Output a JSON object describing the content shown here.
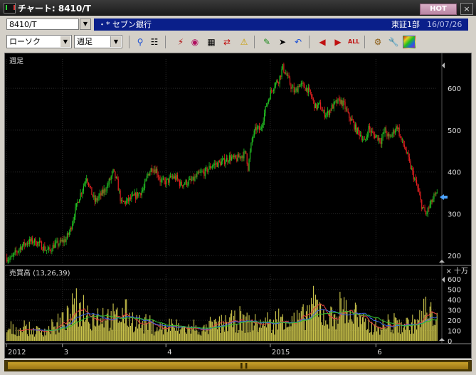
{
  "window": {
    "title": "チャート: 8410/T",
    "hot_label": "HOT",
    "close_glyph": "×"
  },
  "info": {
    "code": "8410/T",
    "stock_name": "セブン銀行",
    "market": "東証1部",
    "date": "16/07/26"
  },
  "toolbar": {
    "chart_type": "ローソク",
    "period": "週足",
    "buttons": [
      "zoom-icon",
      "crosshair-icon",
      "wave-icon",
      "magnify-icon",
      "table-icon",
      "arrows-icon",
      "warning-icon",
      "pencil-icon",
      "cursor-icon",
      "undo-icon",
      "move-left-icon",
      "move-right-icon",
      "all-icon",
      "settings-icon",
      "wrench-icon",
      "palette-icon"
    ],
    "all_label": "ALL"
  },
  "chart_data": [
    {
      "type": "candlestick",
      "panel_label": "週足",
      "ylim": [
        180,
        670
      ],
      "yticks": [
        200,
        300,
        400,
        500,
        600
      ],
      "x_labels": [
        "2012",
        "3",
        "4",
        "2015",
        "6"
      ],
      "current_price_marker": 340,
      "up_color": "#23c423",
      "down_color": "#e02020",
      "trend_points": [
        [
          0,
          195
        ],
        [
          4,
          192
        ],
        [
          8,
          205
        ],
        [
          14,
          222
        ],
        [
          20,
          232
        ],
        [
          26,
          235
        ],
        [
          32,
          228
        ],
        [
          38,
          215
        ],
        [
          42,
          212
        ],
        [
          46,
          225
        ],
        [
          52,
          230
        ],
        [
          58,
          240
        ],
        [
          62,
          262
        ],
        [
          66,
          300
        ],
        [
          70,
          335
        ],
        [
          74,
          360
        ],
        [
          78,
          390
        ],
        [
          82,
          355
        ],
        [
          86,
          330
        ],
        [
          92,
          345
        ],
        [
          98,
          365
        ],
        [
          104,
          400
        ],
        [
          108,
          375
        ],
        [
          112,
          325
        ],
        [
          118,
          330
        ],
        [
          124,
          340
        ],
        [
          130,
          350
        ],
        [
          134,
          360
        ],
        [
          138,
          395
        ],
        [
          142,
          410
        ],
        [
          146,
          405
        ],
        [
          150,
          380
        ],
        [
          154,
          375
        ],
        [
          158,
          380
        ],
        [
          162,
          388
        ],
        [
          166,
          385
        ],
        [
          170,
          370
        ],
        [
          176,
          375
        ],
        [
          182,
          380
        ],
        [
          188,
          395
        ],
        [
          194,
          400
        ],
        [
          200,
          415
        ],
        [
          206,
          420
        ],
        [
          212,
          425
        ],
        [
          218,
          435
        ],
        [
          224,
          430
        ],
        [
          230,
          440
        ],
        [
          234,
          445
        ],
        [
          236,
          410
        ],
        [
          240,
          480
        ],
        [
          244,
          505
        ],
        [
          248,
          500
        ],
        [
          250,
          520
        ],
        [
          254,
          560
        ],
        [
          258,
          590
        ],
        [
          262,
          610
        ],
        [
          266,
          620
        ],
        [
          270,
          650
        ],
        [
          274,
          630
        ],
        [
          278,
          605
        ],
        [
          282,
          590
        ],
        [
          286,
          610
        ],
        [
          290,
          605
        ],
        [
          294,
          598
        ],
        [
          298,
          580
        ],
        [
          302,
          555
        ],
        [
          306,
          560
        ],
        [
          310,
          540
        ],
        [
          314,
          540
        ],
        [
          318,
          555
        ],
        [
          322,
          565
        ],
        [
          326,
          570
        ],
        [
          330,
          560
        ],
        [
          334,
          535
        ],
        [
          338,
          520
        ],
        [
          342,
          500
        ],
        [
          346,
          490
        ],
        [
          350,
          470
        ],
        [
          354,
          505
        ],
        [
          358,
          490
        ],
        [
          362,
          485
        ],
        [
          366,
          475
        ],
        [
          370,
          500
        ],
        [
          374,
          480
        ],
        [
          378,
          495
        ],
        [
          382,
          510
        ],
        [
          386,
          475
        ],
        [
          390,
          455
        ],
        [
          394,
          420
        ],
        [
          398,
          390
        ],
        [
          402,
          360
        ],
        [
          406,
          320
        ],
        [
          410,
          298
        ],
        [
          414,
          320
        ],
        [
          418,
          340
        ],
        [
          421,
          345
        ]
      ],
      "n_candles": 422
    },
    {
      "type": "bar",
      "panel_label": "売買高 (13,26,39)",
      "unit_label": "× 十万",
      "ylim": [
        0,
        650
      ],
      "yticks": [
        0,
        100,
        200,
        300,
        400,
        500,
        600
      ],
      "bar_color": "#c9c24a",
      "ma_periods": [
        13,
        26,
        39
      ],
      "ma_colors": [
        "#e04040",
        "#3b63e0",
        "#2fbf2f"
      ],
      "volume_profile": [
        [
          0,
          160
        ],
        [
          20,
          180
        ],
        [
          40,
          150
        ],
        [
          60,
          170
        ],
        [
          70,
          200
        ],
        [
          80,
          300
        ],
        [
          96,
          420
        ],
        [
          110,
          520
        ],
        [
          120,
          360
        ],
        [
          140,
          420
        ],
        [
          150,
          300
        ],
        [
          160,
          380
        ],
        [
          170,
          420
        ],
        [
          180,
          320
        ],
        [
          200,
          220
        ],
        [
          220,
          200
        ],
        [
          240,
          180
        ],
        [
          260,
          190
        ],
        [
          280,
          160
        ],
        [
          300,
          240
        ],
        [
          320,
          300
        ],
        [
          340,
          290
        ],
        [
          360,
          260
        ],
        [
          380,
          230
        ],
        [
          390,
          280
        ],
        [
          395,
          450
        ],
        [
          400,
          300
        ],
        [
          420,
          320
        ],
        [
          440,
          560
        ],
        [
          460,
          320
        ],
        [
          480,
          540
        ],
        [
          500,
          300
        ],
        [
          520,
          230
        ],
        [
          540,
          220
        ],
        [
          560,
          240
        ],
        [
          580,
          260
        ],
        [
          600,
          380
        ],
        [
          610,
          400
        ],
        [
          615,
          560
        ]
      ]
    }
  ]
}
